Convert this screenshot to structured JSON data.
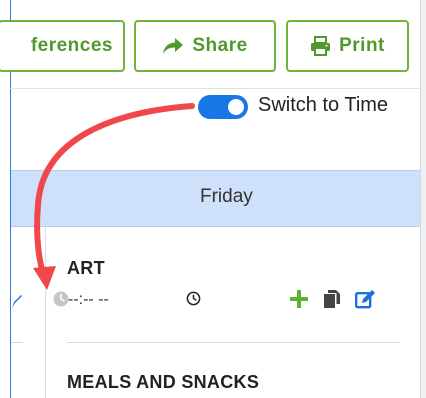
{
  "toolbar": {
    "preferences_label": "ferences",
    "share_label": "Share",
    "print_label": "Print"
  },
  "toggle": {
    "label": "Switch to Time",
    "on": true
  },
  "calendar": {
    "day": "Friday",
    "activity": {
      "title": "ART",
      "time_value": "--:-- --"
    },
    "next_section": "MEALS AND SNACKS"
  },
  "icons": {
    "share": "share-arrow-icon",
    "print": "printer-icon",
    "clock": "clock-icon",
    "add": "plus-icon",
    "copy": "copy-icon",
    "edit": "edit-icon"
  },
  "colors": {
    "accent_green": "#4f9a2a",
    "toggle_blue": "#1976e6",
    "header_blue": "#cfe0fb",
    "annotation_red": "#f0474b"
  }
}
